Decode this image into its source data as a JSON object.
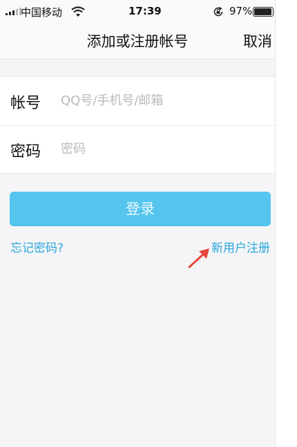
{
  "status_bar": {
    "carrier": "中国移动",
    "time": "17:39",
    "battery": "97%",
    "battery_level": 0.97,
    "icons": [
      "signal-icon",
      "wifi-icon",
      "orientation-lock-icon",
      "battery-icon"
    ]
  },
  "nav": {
    "title": "添加或注册帐号",
    "cancel_label": "取消"
  },
  "form": {
    "account_label": "帐号",
    "account_placeholder": "QQ号/手机号/邮箱",
    "account_value": "",
    "password_label": "密码",
    "password_placeholder": "密码",
    "password_value": ""
  },
  "actions": {
    "login_label": "登录",
    "forgot_label": "忘记密码?",
    "register_label": "新用户注册"
  },
  "colors": {
    "accent": "#55c4ee",
    "link": "#2aa6dd",
    "annotation_arrow": "#e8453c",
    "background": "#f5f5f7"
  }
}
